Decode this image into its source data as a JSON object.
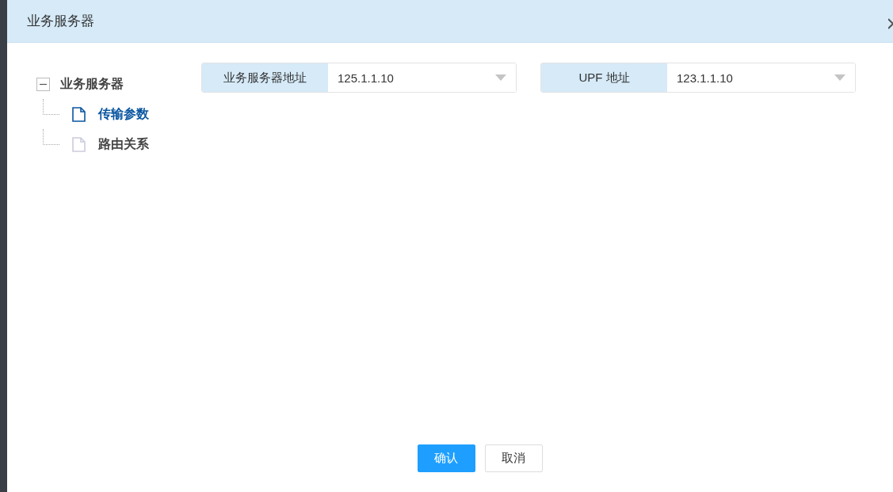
{
  "dialog": {
    "title": "业务服务器"
  },
  "tree": [
    {
      "label": "业务服务器",
      "expanded": true,
      "children": [
        {
          "label": "传输参数",
          "selected": true
        },
        {
          "label": "路由关系",
          "selected": false
        }
      ]
    }
  ],
  "fields": [
    {
      "label": "业务服务器地址",
      "value": "125.1.1.10"
    },
    {
      "label": "UPF 地址",
      "value": "123.1.1.10"
    }
  ],
  "buttons": [
    {
      "label": "确认",
      "kind": "primary"
    },
    {
      "label": "取消",
      "kind": "default"
    }
  ]
}
